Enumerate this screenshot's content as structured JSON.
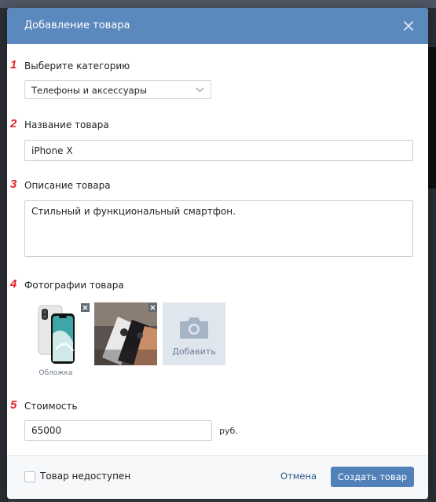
{
  "colors": {
    "header_bg": "#5b88bd",
    "step_number": "#e0252b",
    "primary_button": "#5181b8",
    "link": "#2a5885"
  },
  "modal": {
    "title": "Добавление товара",
    "close_icon": "close-icon"
  },
  "form": {
    "category": {
      "step": "1",
      "label": "Выберите категорию",
      "value": "Телефоны и аксессуары"
    },
    "name": {
      "step": "2",
      "label": "Название товара",
      "value": "iPhone X"
    },
    "description": {
      "step": "3",
      "label": "Описание товара",
      "value": "Стильный и функциональный смартфон."
    },
    "photos": {
      "step": "4",
      "label": "Фотографии товара",
      "cover_caption": "Обложка",
      "add_label": "Добавить"
    },
    "price": {
      "step": "5",
      "label": "Стоимость",
      "value": "65000",
      "currency": "руб."
    }
  },
  "footer": {
    "unavailable_label": "Товар недоступен",
    "cancel_label": "Отмена",
    "submit_label": "Создать товар"
  }
}
